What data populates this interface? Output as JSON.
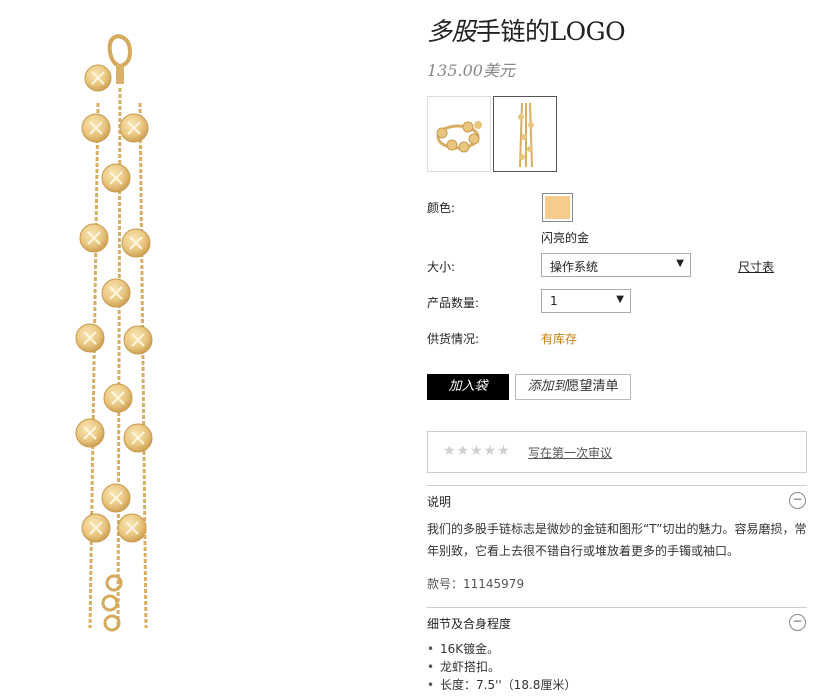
{
  "product": {
    "title_italic": "多股",
    "title_rest": "手链的LOGO",
    "price": "135.00美元"
  },
  "options": {
    "color_label": "颜色:",
    "color_name": "闪亮的金",
    "color_hex": "#f6cc8c",
    "size_label": "大小:",
    "size_value": "操作系统",
    "size_chart": "尺寸表",
    "qty_label": "产品数量:",
    "qty_value": "1",
    "availability_label": "供货情况:",
    "availability_value": "有库存"
  },
  "actions": {
    "add_to_bag": "加入袋",
    "wishlist_italic": "添加到",
    "wishlist_rest": "愿望清单"
  },
  "reviews": {
    "stars": "★★★★★",
    "write_review": "写在第一次审议"
  },
  "description": {
    "heading": "说明",
    "text": "我们的多股手链标志是微妙的金链和图形“T”切出的魅力。容易磨损，常年别致，它看上去很不错自行或堆放着更多的手镯或袖口。",
    "sku": "款号：11145979",
    "toggle": "−"
  },
  "details": {
    "heading": "细节及合身程度",
    "toggle": "−",
    "items": [
      "16K镀金。",
      "龙虾搭扣。",
      "长度：7.5''（18.8厘米）"
    ]
  }
}
